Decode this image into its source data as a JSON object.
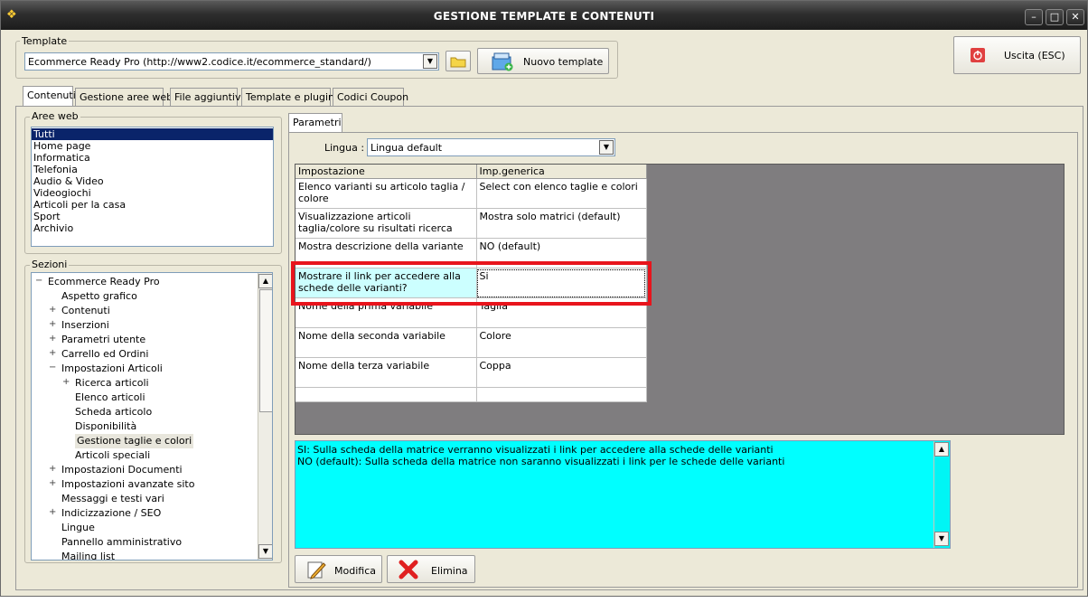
{
  "window": {
    "title": "GESTIONE TEMPLATE E CONTENUTI",
    "minimize": "–",
    "maximize": "□",
    "close": "✕"
  },
  "template": {
    "group_label": "Template",
    "selected": "Ecommerce Ready Pro (http://www2.codice.it/ecommerce_standard/)",
    "new_button": "Nuovo template"
  },
  "exit_button": "Uscita (ESC)",
  "tabs": [
    {
      "label": "Contenuti",
      "active": true
    },
    {
      "label": "Gestione aree web"
    },
    {
      "label": "File aggiuntivi"
    },
    {
      "label": "Template e plugins"
    },
    {
      "label": "Codici Coupon"
    }
  ],
  "aree_web": {
    "label": "Aree web",
    "items": [
      "Tutti",
      "Home page",
      "Informatica",
      "Telefonia",
      "Audio & Video",
      "Videogiochi",
      "Articoli per la casa",
      "Sport",
      "Archivio"
    ],
    "selected_index": 0
  },
  "sezioni": {
    "label": "Sezioni",
    "items": [
      {
        "label": "Ecommerce Ready Pro",
        "exp": "−",
        "indent": 0
      },
      {
        "label": "Aspetto grafico",
        "exp": "",
        "indent": 1
      },
      {
        "label": "Contenuti",
        "exp": "+",
        "indent": 1
      },
      {
        "label": "Inserzioni",
        "exp": "+",
        "indent": 1
      },
      {
        "label": "Parametri utente",
        "exp": "+",
        "indent": 1
      },
      {
        "label": "Carrello ed Ordini",
        "exp": "+",
        "indent": 1
      },
      {
        "label": "Impostazioni Articoli",
        "exp": "−",
        "indent": 1
      },
      {
        "label": "Ricerca articoli",
        "exp": "+",
        "indent": 2
      },
      {
        "label": "Elenco articoli",
        "exp": "",
        "indent": 2
      },
      {
        "label": "Scheda articolo",
        "exp": "",
        "indent": 2
      },
      {
        "label": "Disponibilità",
        "exp": "",
        "indent": 2
      },
      {
        "label": "Gestione taglie e colori",
        "exp": "",
        "indent": 2,
        "selected": true
      },
      {
        "label": "Articoli speciali",
        "exp": "",
        "indent": 2
      },
      {
        "label": "Impostazioni Documenti",
        "exp": "+",
        "indent": 1
      },
      {
        "label": "Impostazioni avanzate sito",
        "exp": "+",
        "indent": 1
      },
      {
        "label": "Messaggi e testi vari",
        "exp": "",
        "indent": 1
      },
      {
        "label": "Indicizzazione / SEO",
        "exp": "+",
        "indent": 1
      },
      {
        "label": "Lingue",
        "exp": "",
        "indent": 1
      },
      {
        "label": "Pannello amministrativo",
        "exp": "",
        "indent": 1
      },
      {
        "label": "Mailing list",
        "exp": "",
        "indent": 1
      }
    ]
  },
  "parametri": {
    "tab_label": "Parametri",
    "lingua_label": "Lingua :",
    "lingua_value": "Lingua default",
    "columns": [
      "Impostazione",
      "Imp.generica"
    ],
    "rows": [
      {
        "setting": "Elenco varianti su articolo taglia / colore",
        "value": "Select con elenco taglie e colori"
      },
      {
        "setting": "Visualizzazione articoli taglia/colore su risultati ricerca",
        "value": "Mostra solo matrici (default)"
      },
      {
        "setting": "Mostra descrizione della variante",
        "value": "NO (default)"
      },
      {
        "setting": "Mostrare il link per accedere alla schede delle varianti?",
        "value": "Si",
        "selected": true
      },
      {
        "setting": "Nome della prima variabile",
        "value": "Taglia"
      },
      {
        "setting": "Nome della seconda variabile",
        "value": "Colore"
      },
      {
        "setting": "Nome della terza variabile",
        "value": "Coppa"
      },
      {
        "setting": "",
        "value": ""
      }
    ],
    "description_lines": [
      "SI: Sulla scheda della matrice verranno visualizzati i link per accedere alla schede delle varianti",
      "NO (default): Sulla scheda della matrice non saranno visualizzati i link per le schede delle varianti"
    ],
    "modifica_button": "Modifica",
    "elimina_button": "Elimina"
  },
  "colors": {
    "description_bg": "#00ffff",
    "highlight_border": "#e8141c",
    "grid_area_bg": "#7f7d7f",
    "selected_row_bg": "#ccffff"
  }
}
